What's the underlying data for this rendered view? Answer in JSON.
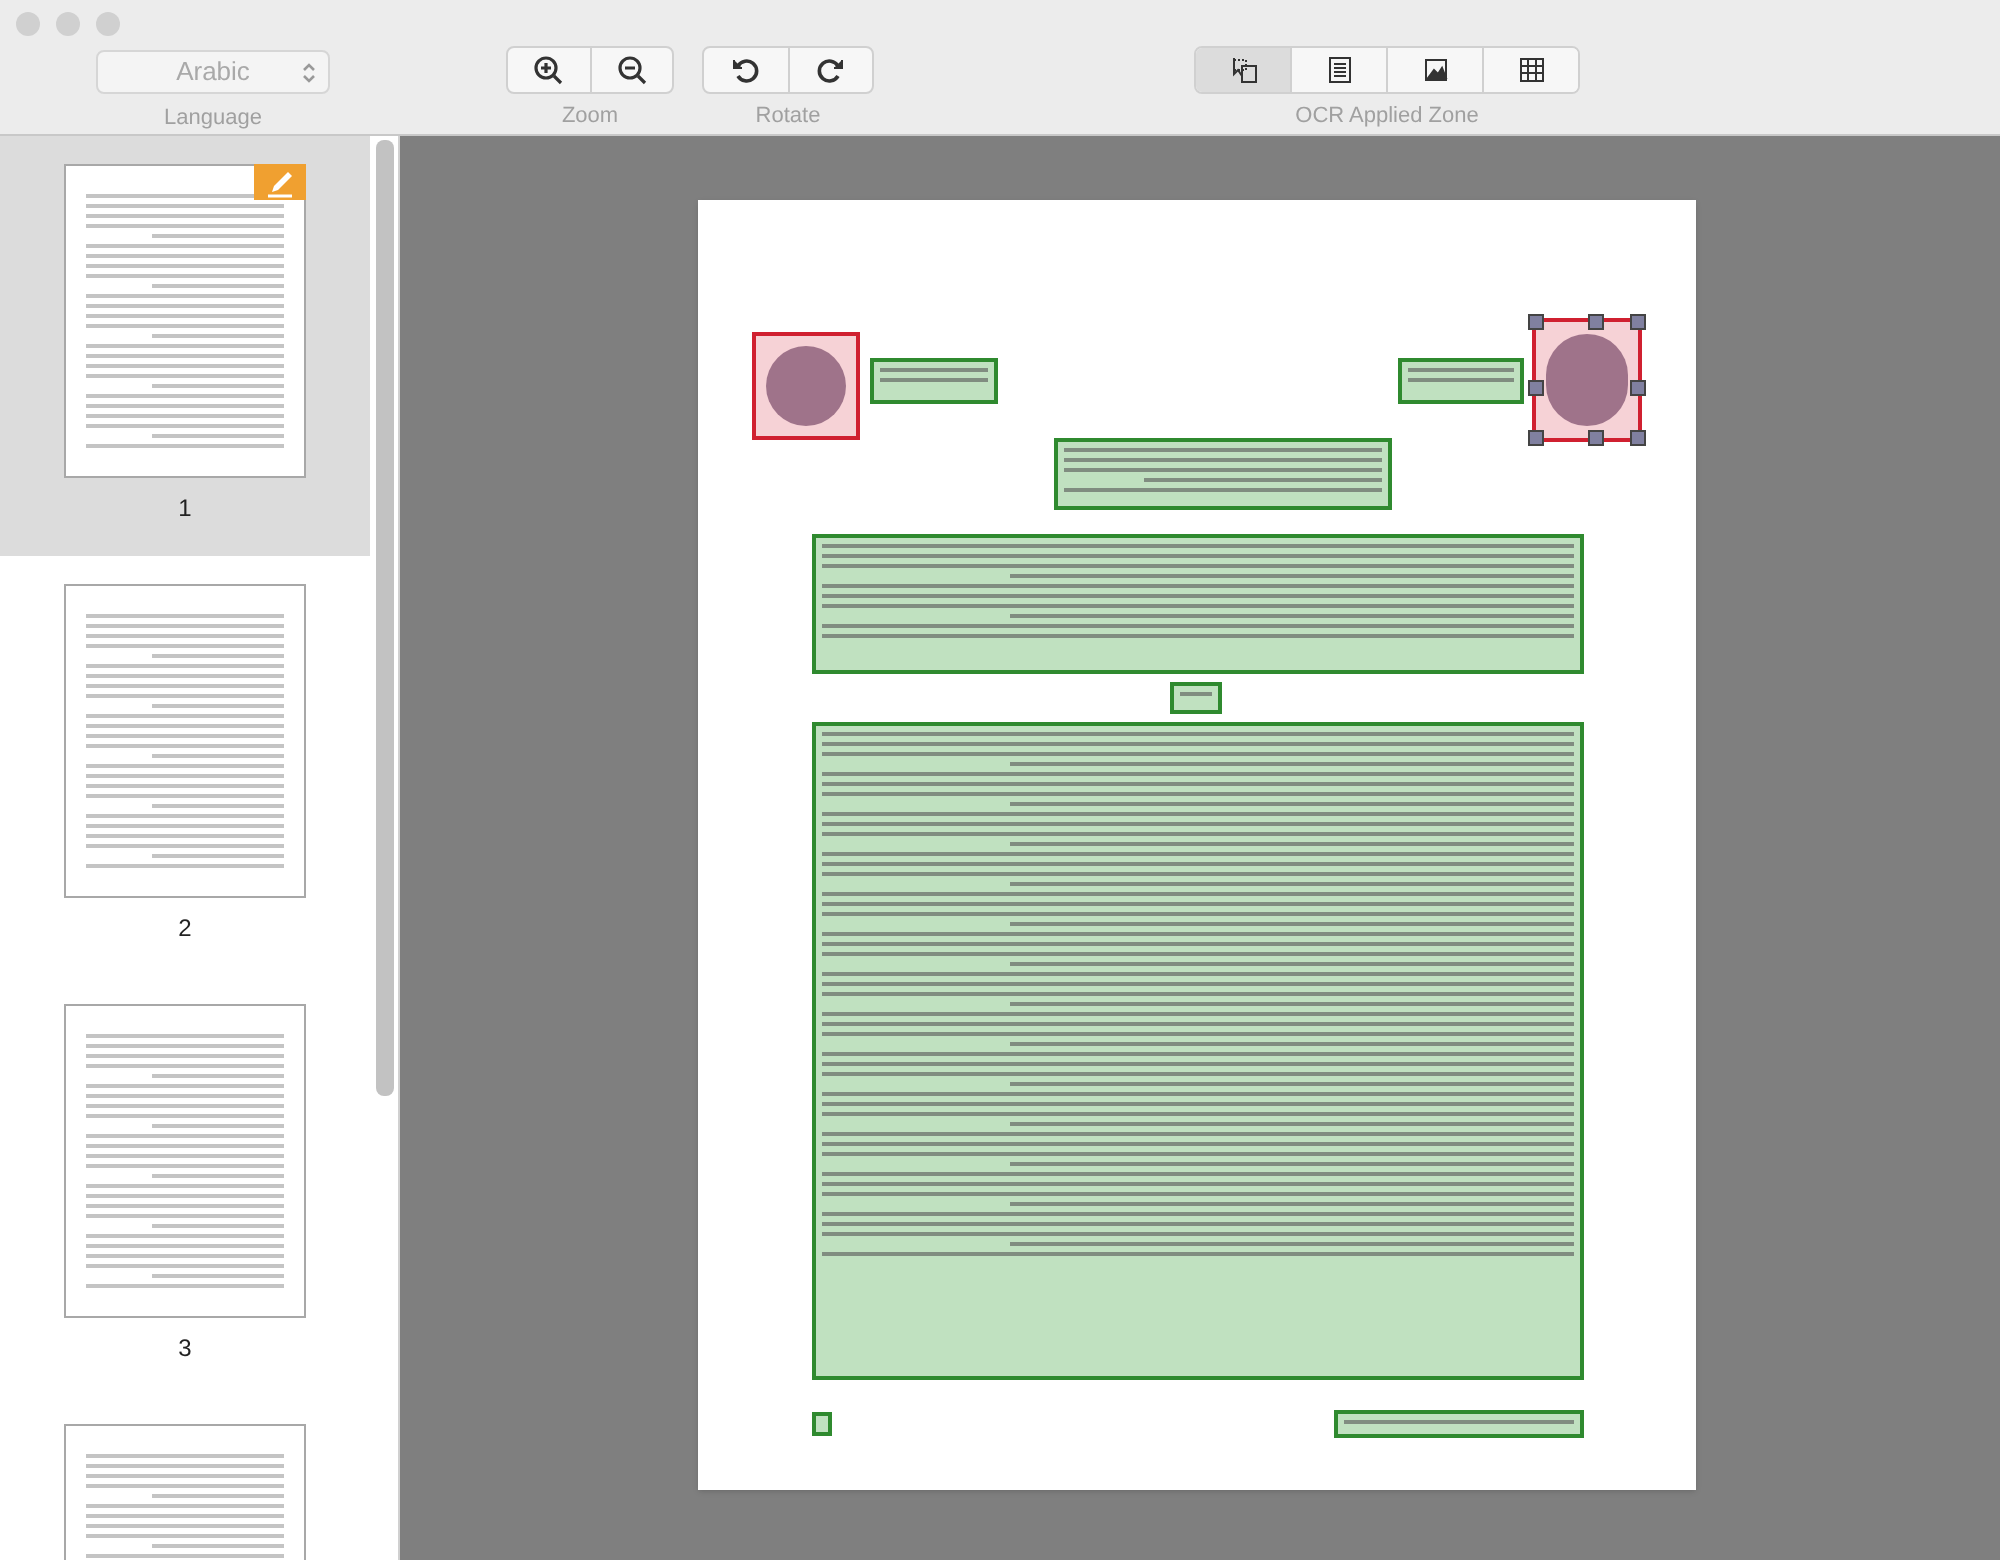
{
  "toolbar": {
    "language": {
      "value": "Arabic",
      "label": "Language"
    },
    "zoom": {
      "label": "Zoom"
    },
    "rotate": {
      "label": "Rotate"
    },
    "ocr_zone": {
      "label": "OCR Applied Zone",
      "modes": [
        {
          "kind": "auto",
          "selected": true
        },
        {
          "kind": "text",
          "selected": false
        },
        {
          "kind": "image",
          "selected": false
        },
        {
          "kind": "table",
          "selected": false
        }
      ]
    }
  },
  "sidebar": {
    "pages": [
      {
        "label": "1",
        "selected": true,
        "edited": true
      },
      {
        "label": "2",
        "selected": false,
        "edited": false
      },
      {
        "label": "3",
        "selected": false,
        "edited": false
      },
      {
        "selected": false,
        "edited": false
      }
    ]
  },
  "document": {
    "zones": [
      {
        "kind": "image",
        "selected": false
      },
      {
        "kind": "text",
        "selected": false
      },
      {
        "kind": "text",
        "selected": false
      },
      {
        "kind": "image",
        "selected": true
      },
      {
        "kind": "text",
        "selected": false
      },
      {
        "kind": "text",
        "selected": false
      },
      {
        "kind": "text",
        "selected": false
      },
      {
        "kind": "text",
        "selected": false
      },
      {
        "kind": "text",
        "selected": false
      },
      {
        "kind": "text",
        "selected": false
      }
    ]
  }
}
